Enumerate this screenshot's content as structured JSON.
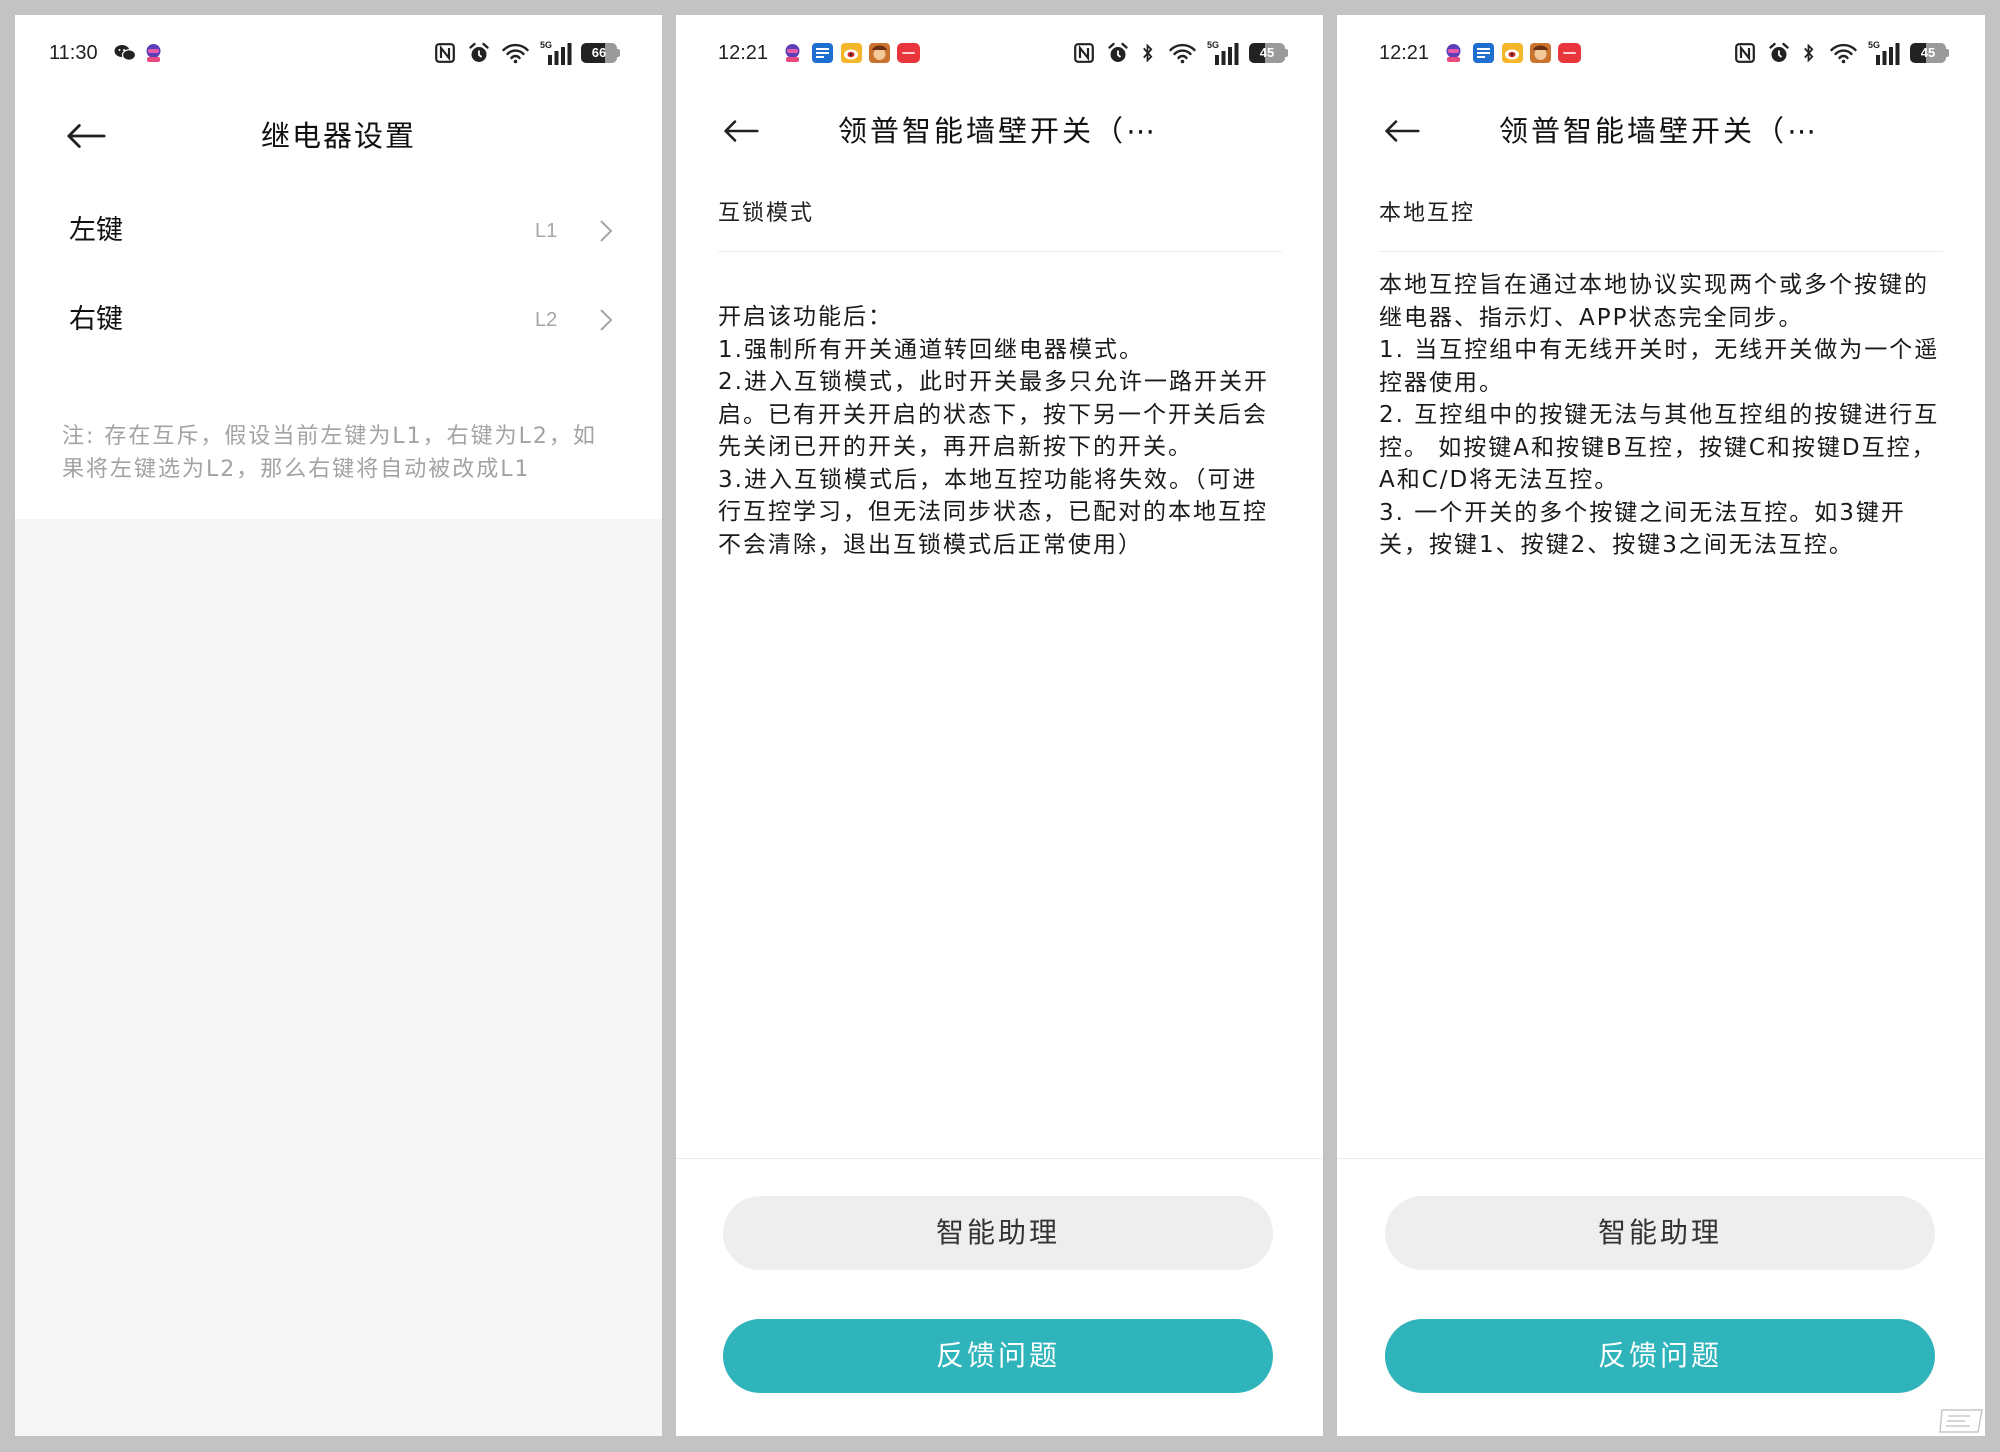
{
  "colors": {
    "accent": "#2fb4bc",
    "secondary_button": "#eeeeee",
    "page_gray": "#f6f6f6",
    "frame": "#c3c3c3"
  },
  "relay_settings": {
    "status_bar": {
      "time": "11:30",
      "network": "5G",
      "battery": "66",
      "left_icons": [
        "wechat-icon",
        "robot-app-icon"
      ],
      "right_icons": [
        "nfc-icon",
        "alarm-icon",
        "wifi-icon",
        "signal-icon",
        "battery-icon"
      ]
    },
    "title": "继电器设置",
    "items": [
      {
        "label": "左键",
        "value": "L1"
      },
      {
        "label": "右键",
        "value": "L2"
      }
    ],
    "note_lines": [
      "注: 存在互斥，假设当前左键为L1，右键为L2，如",
      "果将左键选为L2，那么右键将自动被改成L1"
    ]
  },
  "interlock": {
    "status_bar": {
      "time": "12:21",
      "network": "5G",
      "battery": "45",
      "left_icons": [
        "robot-app-icon",
        "message-app-icon",
        "weibo-icon",
        "game-app-icon",
        "red-app-icon"
      ],
      "right_icons": [
        "nfc-icon",
        "alarm-icon",
        "bluetooth-icon",
        "wifi-icon",
        "signal-icon",
        "battery-icon"
      ]
    },
    "title": "领普智能墙壁开关（⋯",
    "section_title": "互锁模式",
    "body_lines": [
      "开启该功能后：",
      "1.强制所有开关通道转回继电器模式。",
      "2.进入互锁模式，此时开关最多只允许一路开关开",
      "启。已有开关开启的状态下，按下另一个开关后会",
      "先关闭已开的开关，再开启新按下的开关。",
      "3.进入互锁模式后，本地互控功能将失效。（可进",
      "行互控学习，但无法同步状态，已配对的本地互控",
      "不会清除，退出互锁模式后正常使用）"
    ],
    "assistant_button": "智能助理",
    "feedback_button": "反馈问题"
  },
  "local_control": {
    "status_bar": {
      "time": "12:21",
      "network": "5G",
      "battery": "45",
      "left_icons": [
        "robot-app-icon",
        "message-app-icon",
        "weibo-icon",
        "game-app-icon",
        "red-app-icon"
      ],
      "right_icons": [
        "nfc-icon",
        "alarm-icon",
        "bluetooth-icon",
        "wifi-icon",
        "signal-icon",
        "battery-icon"
      ]
    },
    "title": "领普智能墙壁开关（⋯",
    "section_title": "本地互控",
    "body_lines": [
      "本地互控旨在通过本地协议实现两个或多个按键的",
      "继电器、指示灯、APP状态完全同步。",
      "1. 当互控组中有无线开关时，无线开关做为一个遥",
      "控器使用。",
      "2. 互控组中的按键无法与其他互控组的按键进行互",
      "控。 如按键A和按键B互控，按键C和按键D互控，",
      "A和C/D将无法互控。",
      "3. 一个开关的多个按键之间无法互控。如3键开",
      "关，按键1、按键2、按键3之间无法互控。"
    ],
    "assistant_button": "智能助理",
    "feedback_button": "反馈问题"
  }
}
